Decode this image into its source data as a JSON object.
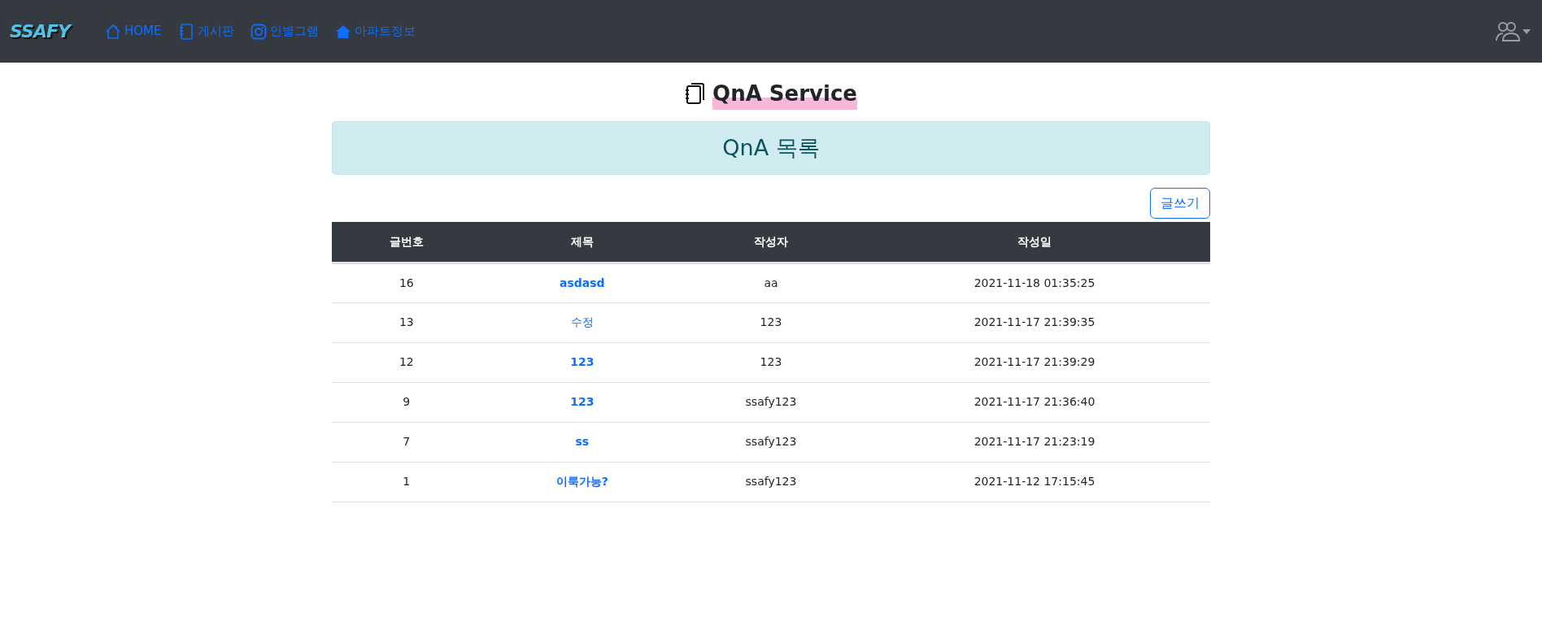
{
  "navbar": {
    "logo": "SSAFY",
    "links": [
      {
        "label": "HOME",
        "kind": "home"
      },
      {
        "label": "게시판",
        "kind": "notebook"
      },
      {
        "label": "인별그램",
        "kind": "instagram"
      },
      {
        "label": "아파트정보",
        "kind": "house"
      }
    ]
  },
  "page_title": "QnA Service",
  "banner": "QnA 목록",
  "write_button": "글쓰기",
  "table": {
    "columns": [
      "글번호",
      "제목",
      "작성자",
      "작성일"
    ],
    "rows": [
      {
        "no": "16",
        "title": "asdasd",
        "bold": true,
        "author": "aa",
        "date": "2021-11-18 01:35:25"
      },
      {
        "no": "13",
        "title": "수정",
        "bold": false,
        "author": "123",
        "date": "2021-11-17 21:39:35"
      },
      {
        "no": "12",
        "title": "123",
        "bold": true,
        "author": "123",
        "date": "2021-11-17 21:39:29"
      },
      {
        "no": "9",
        "title": "123",
        "bold": true,
        "author": "ssafy123",
        "date": "2021-11-17 21:36:40"
      },
      {
        "no": "7",
        "title": "ss",
        "bold": true,
        "author": "ssafy123",
        "date": "2021-11-17 21:23:19"
      },
      {
        "no": "1",
        "title": "이룩가능?",
        "bold": true,
        "author": "ssafy123",
        "date": "2021-11-12 17:15:45"
      }
    ]
  }
}
